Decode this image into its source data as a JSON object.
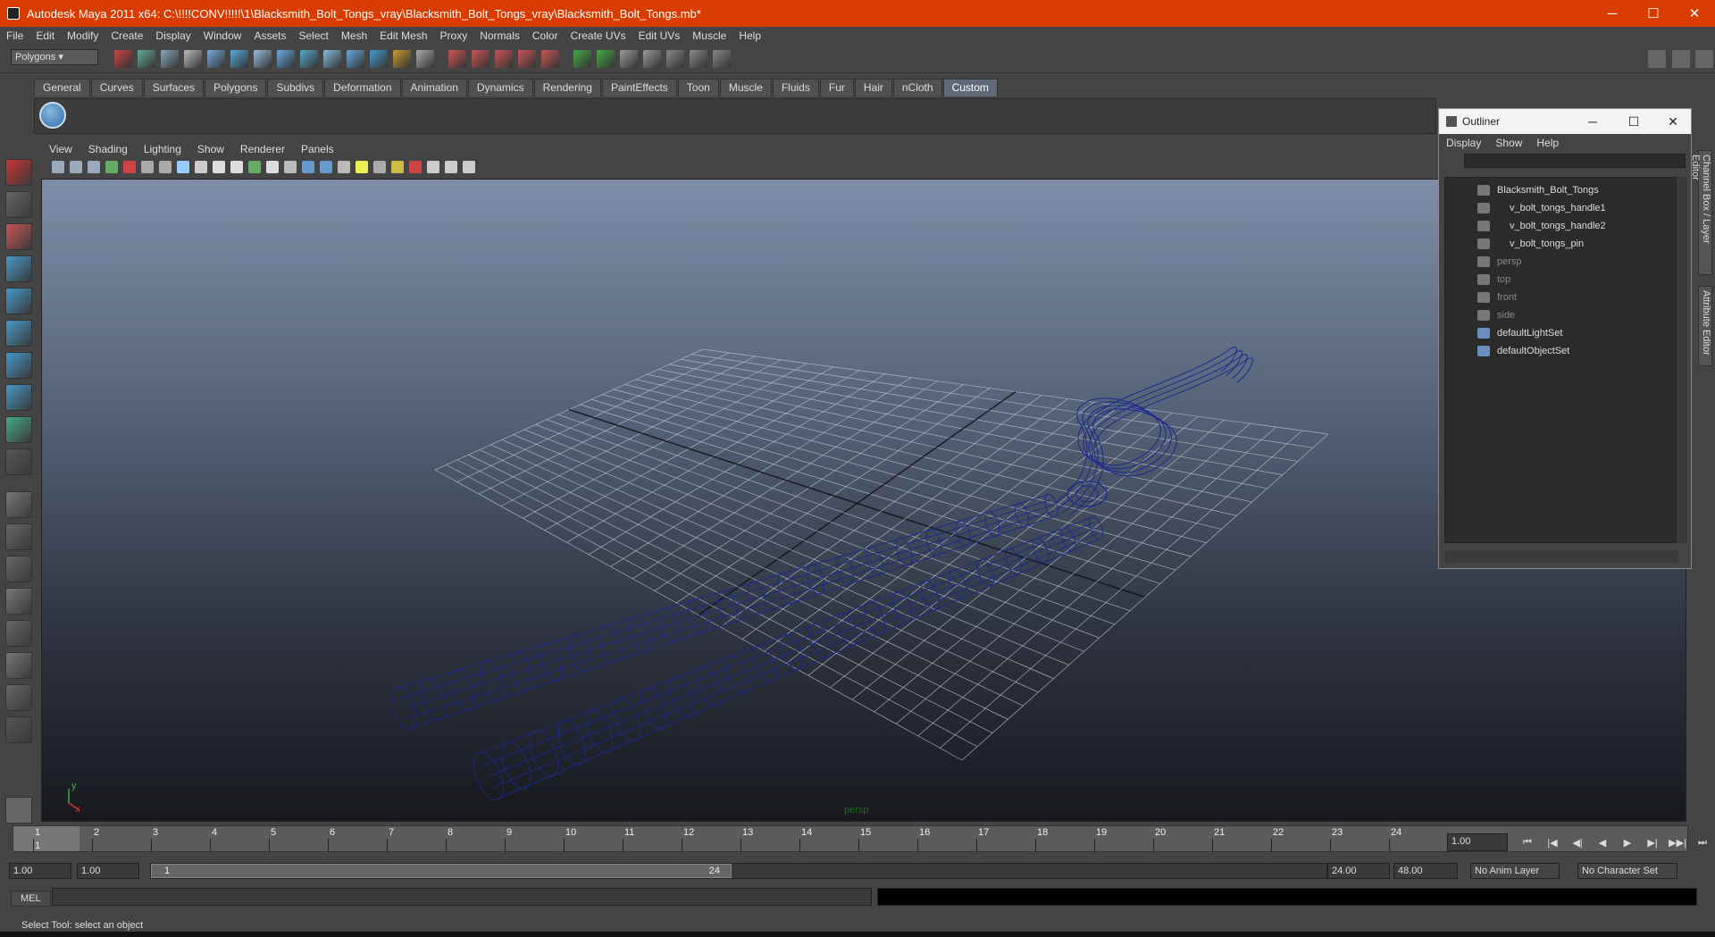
{
  "window": {
    "title": "Autodesk Maya 2011 x64: C:\\!!!!CONV!!!!!\\1\\Blacksmith_Bolt_Tongs_vray\\Blacksmith_Bolt_Tongs_vray\\Blacksmith_Bolt_Tongs.mb*",
    "controls": {
      "minimize": "─",
      "maximize": "☐",
      "close": "✕"
    }
  },
  "menubar": [
    "File",
    "Edit",
    "Modify",
    "Create",
    "Display",
    "Window",
    "Assets",
    "Select",
    "Mesh",
    "Edit Mesh",
    "Proxy",
    "Normals",
    "Color",
    "Create UVs",
    "Edit UVs",
    "Muscle",
    "Help"
  ],
  "statusline": {
    "mode": "Polygons"
  },
  "shelf": {
    "tabs": [
      "General",
      "Curves",
      "Surfaces",
      "Polygons",
      "Subdivs",
      "Deformation",
      "Animation",
      "Dynamics",
      "Rendering",
      "PaintEffects",
      "Toon",
      "Muscle",
      "Fluids",
      "Fur",
      "Hair",
      "nCloth",
      "Custom"
    ],
    "active": "Custom"
  },
  "viewport": {
    "menu": [
      "View",
      "Shading",
      "Lighting",
      "Show",
      "Renderer",
      "Panels"
    ],
    "camera": "persp",
    "axis_y": "y",
    "axis_x": "x",
    "wire_color": "#1a2a8c"
  },
  "outliner": {
    "title": "Outliner",
    "menu": [
      "Display",
      "Show",
      "Help"
    ],
    "items": [
      {
        "label": "Blacksmith_Bolt_Tongs",
        "level": 0,
        "dim": false
      },
      {
        "label": "v_bolt_tongs_handle1",
        "level": 1,
        "dim": false
      },
      {
        "label": "v_bolt_tongs_handle2",
        "level": 1,
        "dim": false
      },
      {
        "label": "v_bolt_tongs_pin",
        "level": 1,
        "dim": false
      },
      {
        "label": "persp",
        "level": 0,
        "dim": true
      },
      {
        "label": "top",
        "level": 0,
        "dim": true
      },
      {
        "label": "front",
        "level": 0,
        "dim": true
      },
      {
        "label": "side",
        "level": 0,
        "dim": true
      },
      {
        "label": "defaultLightSet",
        "level": 0,
        "dim": false
      },
      {
        "label": "defaultObjectSet",
        "level": 0,
        "dim": false
      }
    ]
  },
  "side_tabs": [
    "Channel Box / Layer Editor",
    "Attribute Editor"
  ],
  "timeline": {
    "start": 1,
    "end": 24,
    "current": "1",
    "current_field": "1.00"
  },
  "range": {
    "start": "1.00",
    "play_start": "1.00",
    "slider_start": "1",
    "slider_end": "24",
    "play_end": "24.00",
    "end": "48.00",
    "anim_layer": "No Anim Layer",
    "character_set": "No Character Set"
  },
  "playback": [
    "⏮",
    "|◀",
    "◀|",
    "◀",
    "▶",
    "▶|",
    "▶▶|",
    "⏭"
  ],
  "cmdline": {
    "label": "MEL"
  },
  "helpline": "Select Tool: select an object"
}
